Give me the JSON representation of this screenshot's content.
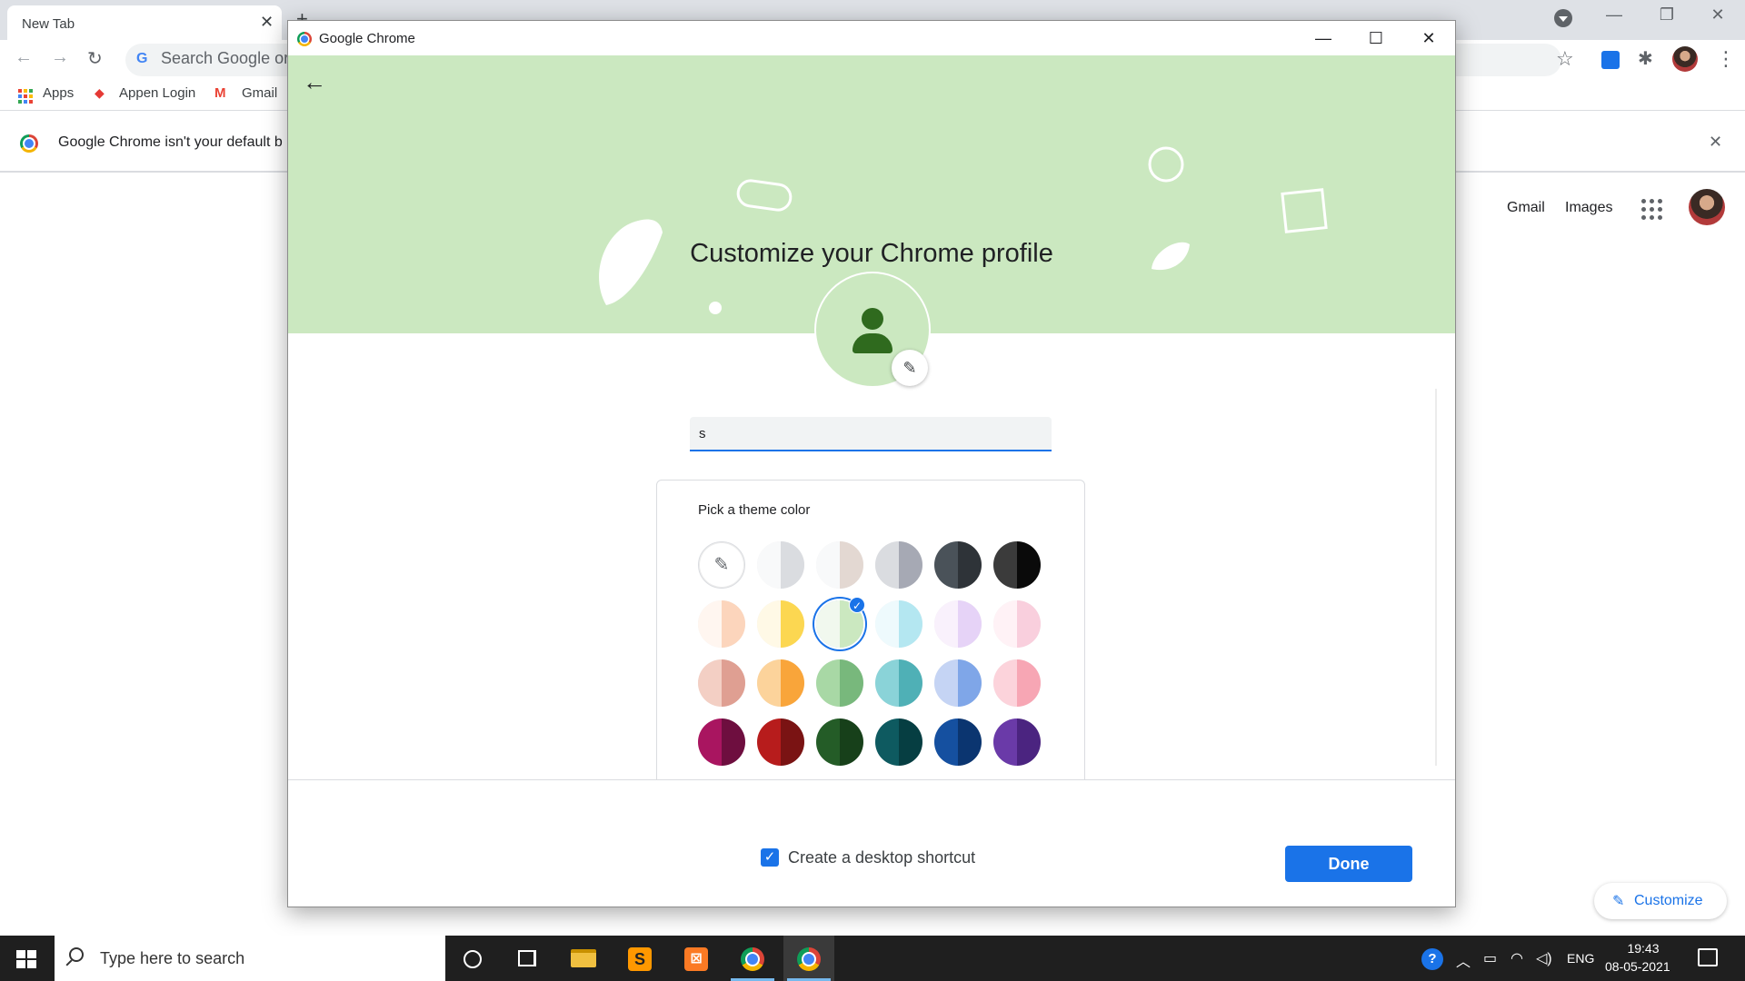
{
  "background_browser": {
    "tab_title": "New Tab",
    "tab_close": "✕",
    "new_tab": "+",
    "omnibox_placeholder": "Search Google or",
    "bookmarks": [
      {
        "label": "Apps"
      },
      {
        "label": "Appen Login"
      },
      {
        "label": "Gmail"
      }
    ],
    "infobar_text": "Google Chrome isn't your default b",
    "infobar_close": "✕",
    "header_links": {
      "gmail": "Gmail",
      "images": "Images"
    },
    "customize_label": "Customize",
    "icons": {
      "star": "☆",
      "puzzle": "✱",
      "menu": "⋮",
      "back": "←",
      "forward": "→",
      "reload": "↻",
      "pencil": "✎",
      "minimize": "—",
      "restore": "❐",
      "close": "✕"
    }
  },
  "dialog": {
    "window_title": "Google Chrome",
    "controls": {
      "minimize": "—",
      "maximize": "☐",
      "close": "✕"
    },
    "back_icon": "←",
    "heading": "Customize your Chrome profile",
    "edit_icon": "✎",
    "name_field_value": "s",
    "theme_picker": {
      "label": "Pick a theme color",
      "custom_icon": "✎",
      "selected_check": "✓",
      "swatches": [
        {
          "row": 0,
          "col": 1,
          "left": "#f8f9fa",
          "right": "#dadce0"
        },
        {
          "row": 0,
          "col": 2,
          "left": "#f8f9fa",
          "right": "#e3d8d2"
        },
        {
          "row": 0,
          "col": 3,
          "left": "#dadce0",
          "right": "#a6a9b4"
        },
        {
          "row": 0,
          "col": 4,
          "left": "#4a5259",
          "right": "#2e3338"
        },
        {
          "row": 0,
          "col": 5,
          "left": "#3b3b3b",
          "right": "#0a0a0a"
        },
        {
          "row": 1,
          "col": 0,
          "left": "#fff6f0",
          "right": "#fcd5bc"
        },
        {
          "row": 1,
          "col": 1,
          "left": "#fff9e6",
          "right": "#fcd751"
        },
        {
          "row": 1,
          "col": 2,
          "left": "#f1f8ee",
          "right": "#cbe8c0",
          "selected": true
        },
        {
          "row": 1,
          "col": 3,
          "left": "#eefafd",
          "right": "#b4e7f1"
        },
        {
          "row": 1,
          "col": 4,
          "left": "#f9f1fc",
          "right": "#e6d3f7"
        },
        {
          "row": 1,
          "col": 5,
          "left": "#fff2f6",
          "right": "#f9cfdd"
        },
        {
          "row": 2,
          "col": 0,
          "left": "#f3cfc4",
          "right": "#df9f92"
        },
        {
          "row": 2,
          "col": 1,
          "left": "#fcd39b",
          "right": "#f9a53a"
        },
        {
          "row": 2,
          "col": 2,
          "left": "#a8d8a5",
          "right": "#78b87c"
        },
        {
          "row": 2,
          "col": 3,
          "left": "#8ad3d8",
          "right": "#4fb0b6"
        },
        {
          "row": 2,
          "col": 4,
          "left": "#c5d4f4",
          "right": "#7fa6e8"
        },
        {
          "row": 2,
          "col": 5,
          "left": "#fcd3db",
          "right": "#f7a6b4"
        },
        {
          "row": 3,
          "col": 0,
          "left": "#a91560",
          "right": "#6e0e3f"
        },
        {
          "row": 3,
          "col": 1,
          "left": "#b71c1c",
          "right": "#7a1313"
        },
        {
          "row": 3,
          "col": 2,
          "left": "#245c27",
          "right": "#17401a"
        },
        {
          "row": 3,
          "col": 3,
          "left": "#0e5a60",
          "right": "#063e42"
        },
        {
          "row": 3,
          "col": 4,
          "left": "#1550a0",
          "right": "#0b3570"
        },
        {
          "row": 3,
          "col": 5,
          "left": "#6a3aa8",
          "right": "#4b2480"
        }
      ]
    },
    "shortcut_checkbox_label": "Create a desktop shortcut",
    "shortcut_checked": true,
    "shortcut_check": "✓",
    "done_label": "Done",
    "banner_color": "#cbe8c0",
    "accent_color": "#1a73e8"
  },
  "taskbar": {
    "search_placeholder": "Type here to search",
    "tray": {
      "help": "?",
      "chevron": "︿",
      "battery": "▭",
      "network": "◠",
      "volume": "◁)",
      "language": "ENG",
      "time": "19:43",
      "date": "08-05-2021"
    },
    "apps": [
      "cortana",
      "task-view",
      "file-explorer",
      "sublime-text",
      "xampp",
      "chrome",
      "chrome-active"
    ]
  }
}
